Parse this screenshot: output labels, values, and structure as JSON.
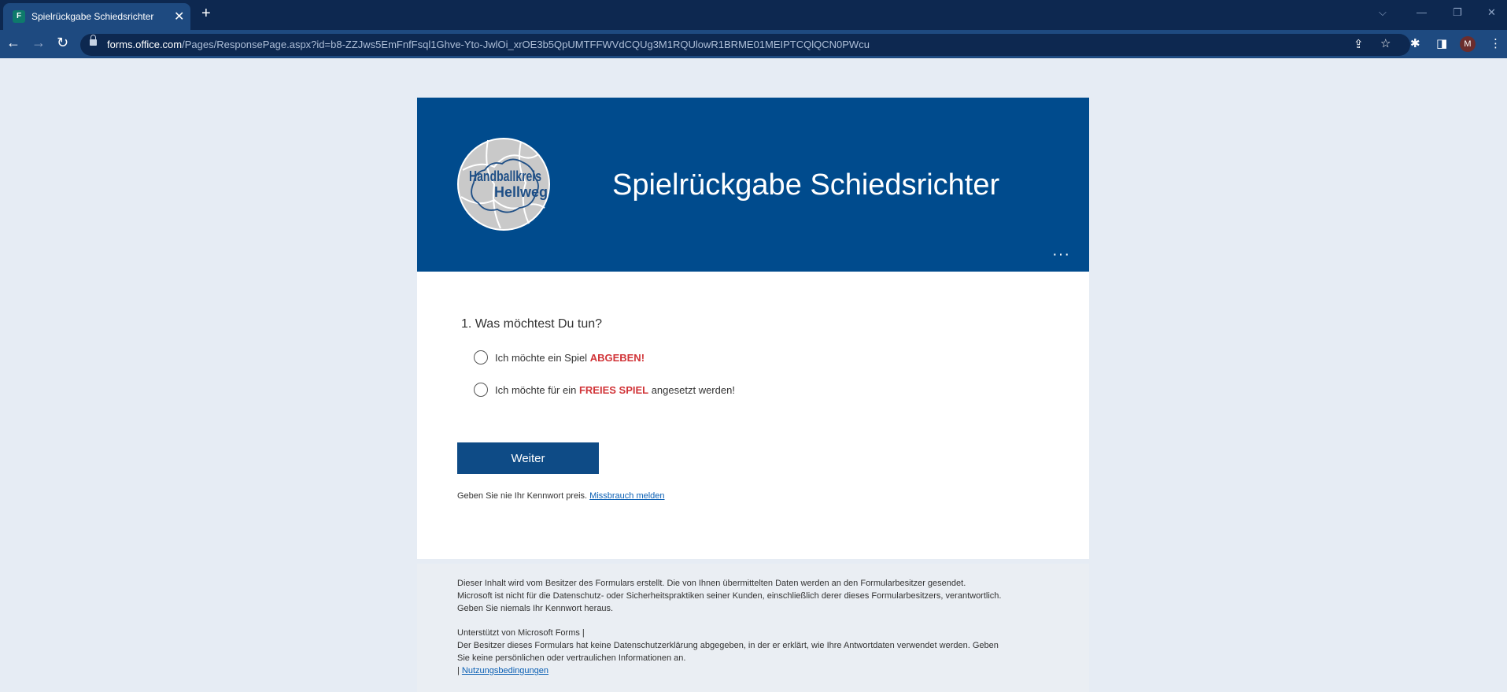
{
  "browser": {
    "tab_title": "Spielrückgabe Schiedsrichter",
    "favicon_text": "F",
    "url_host": "forms.office.com",
    "url_path": "/Pages/ResponsePage.aspx?id=b8-ZZJws5EmFnfFsql1Ghve-Yto-JwlOi_xrOE3b5QpUMTFFWVdCQUg3M1RQUlowR1BRME01MEIPTCQlQCN0PWcu",
    "avatar_initial": "M"
  },
  "form": {
    "title": "Spielrückgabe Schiedsrichter",
    "logo": {
      "text_line1": "Handballkreis",
      "text_line2": "Hellweg"
    },
    "question": "1. Was möchtest Du tun?",
    "options": [
      {
        "prefix": "Ich möchte ein Spiel ",
        "emphasis": "ABGEBEN!",
        "suffix": ""
      },
      {
        "prefix": "Ich möchte für ein ",
        "emphasis": "FREIES SPIEL",
        "suffix": " angesetzt werden!"
      }
    ],
    "next_label": "Weiter",
    "password_note": "Geben Sie nie Ihr Kennwort preis.",
    "report_link": "Missbrauch melden"
  },
  "footer": {
    "line1": "Dieser Inhalt wird vom Besitzer des Formulars erstellt. Die von Ihnen übermittelten Daten werden an den Formularbesitzer gesendet.",
    "line2": "Microsoft ist nicht für die Datenschutz- oder Sicherheitspraktiken seiner Kunden, einschließlich derer dieses Formularbesitzers, verantwortlich.",
    "line3": "Geben Sie niemals Ihr Kennwort heraus.",
    "line4": "Unterstützt von Microsoft Forms |",
    "line5": "Der Besitzer dieses Formulars hat keine Datenschutzerklärung abgegeben, in der er erklärt, wie Ihre Antwortdaten verwendet werden. Geben",
    "line6": "Sie keine persönlichen oder vertraulichen Informationen an.",
    "line7_prefix": "| ",
    "terms_link": "Nutzungsbedingungen"
  },
  "colors": {
    "header_bg": "#004b8d",
    "page_bg": "#e6ecf4",
    "accent_red": "#d13438",
    "button_bg": "#0e4b86"
  }
}
